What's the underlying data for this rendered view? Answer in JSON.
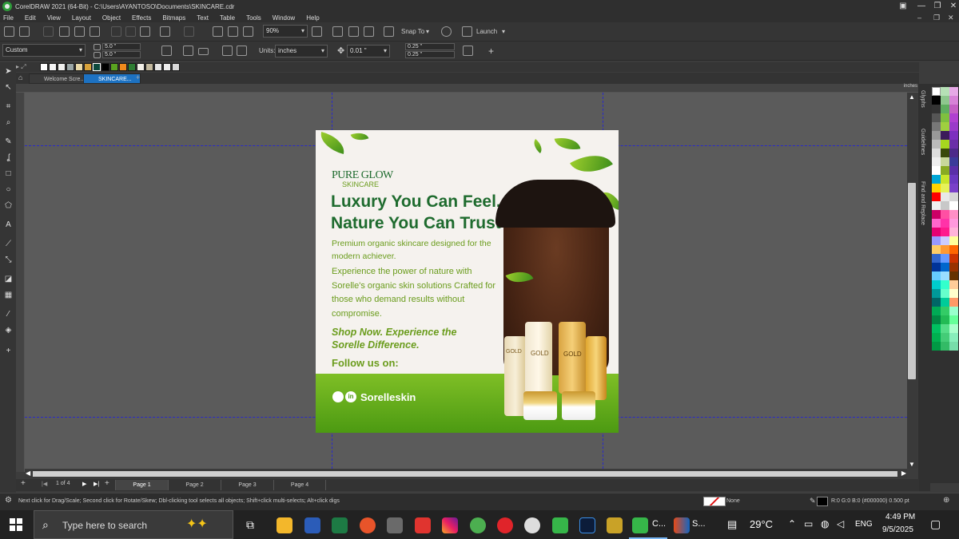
{
  "window": {
    "title": "CorelDRAW 2021 (64-Bit) - C:\\Users\\AYANTOSO\\Documents\\SKINCARE.cdr"
  },
  "menu": [
    "File",
    "Edit",
    "View",
    "Layout",
    "Object",
    "Effects",
    "Bitmaps",
    "Text",
    "Table",
    "Tools",
    "Window",
    "Help"
  ],
  "toolbar": {
    "zoom": "90%",
    "snap_to": "Snap To",
    "launch": "Launch"
  },
  "propertybar": {
    "preset": "Custom",
    "width": "5.0 \"",
    "height": "5.0 \"",
    "units_label": "Units:",
    "units": "inches",
    "nudge": "0.01 \"",
    "dup_x": "0.25 \"",
    "dup_y": "0.25 \""
  },
  "tabs": {
    "welcome": "Welcome Scre...",
    "doc": "SKINCARE..."
  },
  "ruler_unit": "inches",
  "dockers": [
    "Glyphs",
    "Guidelines",
    "Find and Replace"
  ],
  "design": {
    "brand": "PURE GLOW",
    "brand_sub": "SKINCARE",
    "headline1": "Luxury You Can Feel.",
    "headline2": "Nature You Can Trust",
    "tagline": "Premium organic skincare designed for the modern achiever.",
    "body": "Experience the power of nature with Sorelle's organic skin solutions Crafted for those who demand results without compromise.",
    "cta": "Shop Now. Experience the Sorelle Difference.",
    "follow": "Follow us on:",
    "handle": "Sorelleskin",
    "bottle_label": "GOLD"
  },
  "pages": {
    "count": "1 of 4",
    "tabs": [
      "Page 1",
      "Page 2",
      "Page 3",
      "Page 4"
    ]
  },
  "status": {
    "hint": "Next click for Drag/Scale; Second click for Rotate/Skew; Dbl-clicking tool selects all objects; Shift+click multi-selects; Alt+click digs",
    "fill": "None",
    "outline": "R:0 G:0 B:0 (#000000)  0.500 pt"
  },
  "taskbar": {
    "search_placeholder": "Type here to search",
    "app_c": "C...",
    "app_s": "S...",
    "temp": "29°C",
    "lang": "ENG",
    "time": "4:49 PM",
    "date": "9/5/2025"
  },
  "colors": {
    "accent": "#1d72c2",
    "brand_green": "#1e6b2e",
    "text_green": "#6a9c1c",
    "guide": "#2929c9"
  }
}
